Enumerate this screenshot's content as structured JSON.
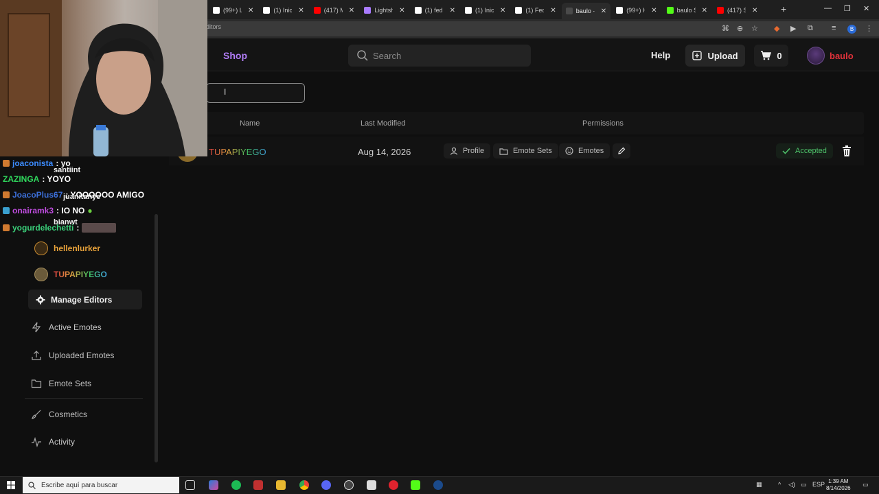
{
  "browser": {
    "tabs": [
      {
        "label": "(99+) Li",
        "color": "#ffffff"
      },
      {
        "label": "(1) Inic",
        "color": "#ffffff"
      },
      {
        "label": "(417) M",
        "color": "#ff0000"
      },
      {
        "label": "Lightsh",
        "color": "#a97bff"
      },
      {
        "label": "(1) fed",
        "color": "#ffffff"
      },
      {
        "label": "(1) Inic",
        "color": "#ffffff"
      },
      {
        "label": "(1) Fed",
        "color": "#ffffff"
      },
      {
        "label": "baulo ·",
        "color": "#4a4a4a"
      },
      {
        "label": "(99+) H",
        "color": "#ffffff"
      },
      {
        "label": "baulo S",
        "color": "#53fc18"
      },
      {
        "label": "(417) S",
        "color": "#ff0000"
      }
    ],
    "url_fragment": "ditors",
    "profile_initial": "B"
  },
  "header": {
    "shop_label": "Shop",
    "search_placeholder": "Search",
    "help_label": "Help",
    "upload_label": "Upload",
    "cart_count": "0",
    "username": "baulo"
  },
  "editors_table": {
    "columns": [
      "Name",
      "Last Modified",
      "Permissions"
    ],
    "rows": [
      {
        "name": "TUPAPIYEGO",
        "last_modified": "Aug 14, 2026",
        "permissions": [
          "Profile",
          "Emote Sets",
          "Emotes"
        ],
        "status": "Accepted"
      }
    ]
  },
  "sidebar": {
    "channels": [
      {
        "name": "hellenlurker",
        "color": "#e8a23a"
      },
      {
        "name": "TUPAPIYEGO",
        "color": "#4aa8d8"
      }
    ],
    "active_item": "Manage Editors",
    "links": [
      "Active Emotes",
      "Uploaded Emotes",
      "Emote Sets",
      "Cosmetics",
      "Activity"
    ]
  },
  "chat": {
    "lines": [
      {
        "user": "joaconista",
        "msg": ": yo",
        "color": "#3c8cff"
      },
      {
        "user": "ZAZINGA",
        "msg": ": YOYO",
        "color": "#2fd65c"
      },
      {
        "user": "JoacoPlus67",
        "msg": ": YOOOOOO AMIGO",
        "color": "#3c6fd8"
      },
      {
        "user": "onairamk3",
        "msg": ": IO NO",
        "color": "#c04de0"
      },
      {
        "user": "yogurdelechetti",
        "msg": ":",
        "color": "#3ad07a"
      }
    ],
    "followers": [
      "santiint",
      "juanitanye",
      "bianwt"
    ]
  },
  "taskbar": {
    "search_placeholder": "Escribe aquí para buscar",
    "lang": "ESP",
    "time": "1:39 AM",
    "date": "8/14/2026"
  }
}
